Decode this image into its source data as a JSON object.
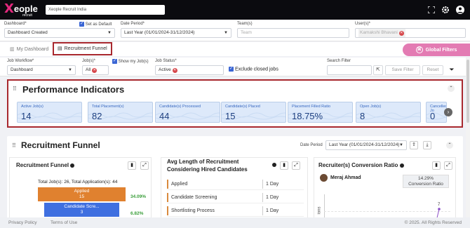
{
  "brand": {
    "logo_mark": "X",
    "logo_word": "eople",
    "logo_sub": "recruit"
  },
  "top": {
    "search_value": "Xeople Recruit India",
    "icons": [
      "fullscreen-icon",
      "gear-icon",
      "user-icon"
    ]
  },
  "filters": {
    "dashboard_label": "Dashboard*",
    "dashboard_value": "Dashboard Created",
    "set_default_label": "Set as Default",
    "date_label": "Date Period*",
    "date_value": "Last Year (01/01/2024-31/12/2024)",
    "team_label": "Team(s)",
    "team_placeholder": "Team",
    "user_label": "User(s)*",
    "user_value": "Kamakshi Bhavani"
  },
  "tabs": {
    "my_dashboard": "My Dashboard",
    "recruitment_funnel": "Recruitment Funnel",
    "global_filters": "Global Filters"
  },
  "row2": {
    "workflow_label": "Job Workflow*",
    "workflow_value": "Dashboard",
    "jobs_label": "Job(s)*",
    "jobs_value": "All",
    "show_my_jobs": "Show my Job(s)",
    "status_label": "Job Status*",
    "status_value": "Active",
    "exclude_closed": "Exclude closed jobs",
    "search_label": "Search Filter",
    "save_filter": "Save Filter",
    "reset": "Reset"
  },
  "perf": {
    "title": "Performance Indicators",
    "cards": [
      {
        "label": "Active Job(s)",
        "value": "14"
      },
      {
        "label": "Total Placement(s)",
        "value": "82"
      },
      {
        "label": "Candidate(s) Processed",
        "value": "44"
      },
      {
        "label": "Candidate(s) Placed",
        "value": "15"
      },
      {
        "label": "Placement Filled Ratio",
        "value": "18.75%"
      },
      {
        "label": "Open Job(s)",
        "value": "8"
      },
      {
        "label": "Cancelled Jo",
        "value": "0"
      }
    ]
  },
  "rf": {
    "title": "Recruitment Funnel",
    "date_label": "Date Period",
    "date_value": "Last Year (01/01/2024-31/12/2024)",
    "funnel_panel": {
      "title": "Recruitment Funnel",
      "summary": "Total Job(s): 26, Total Application(s): 44",
      "stages": [
        {
          "name": "Applied",
          "count": "15",
          "pct": "34.09%",
          "color": "#e0812f"
        },
        {
          "name": "Candidate Scre...",
          "count": "3",
          "pct": "6.82%",
          "color": "#3f6fe0"
        }
      ]
    },
    "avg_panel": {
      "title_line1": "Avg Length of Recruitment",
      "title_line2": "Considering Hired Candidates",
      "rows": [
        {
          "stage": "Applied",
          "days": "1 Day"
        },
        {
          "stage": "Candidate Screening",
          "days": "1 Day"
        },
        {
          "stage": "Shortlisting Process",
          "days": "1 Day"
        }
      ]
    },
    "conv_panel": {
      "title": "Recruiter(s) Conversion Ratio",
      "recruiter": "Meraj Ahmad",
      "ratio": "14.29%",
      "ratio_label": "Conversion Ratio",
      "axis_label": "ions",
      "point_value": "7"
    }
  },
  "footer": {
    "privacy": "Privacy Policy",
    "terms": "Terms of Use",
    "copyright": "© 2025. All Rights Reserved"
  },
  "colors": {
    "topbar": "#0b0b0f",
    "highlight": "#a8282e",
    "card_bg": "#dde9fa",
    "accent_pink": "#e37bb3"
  }
}
